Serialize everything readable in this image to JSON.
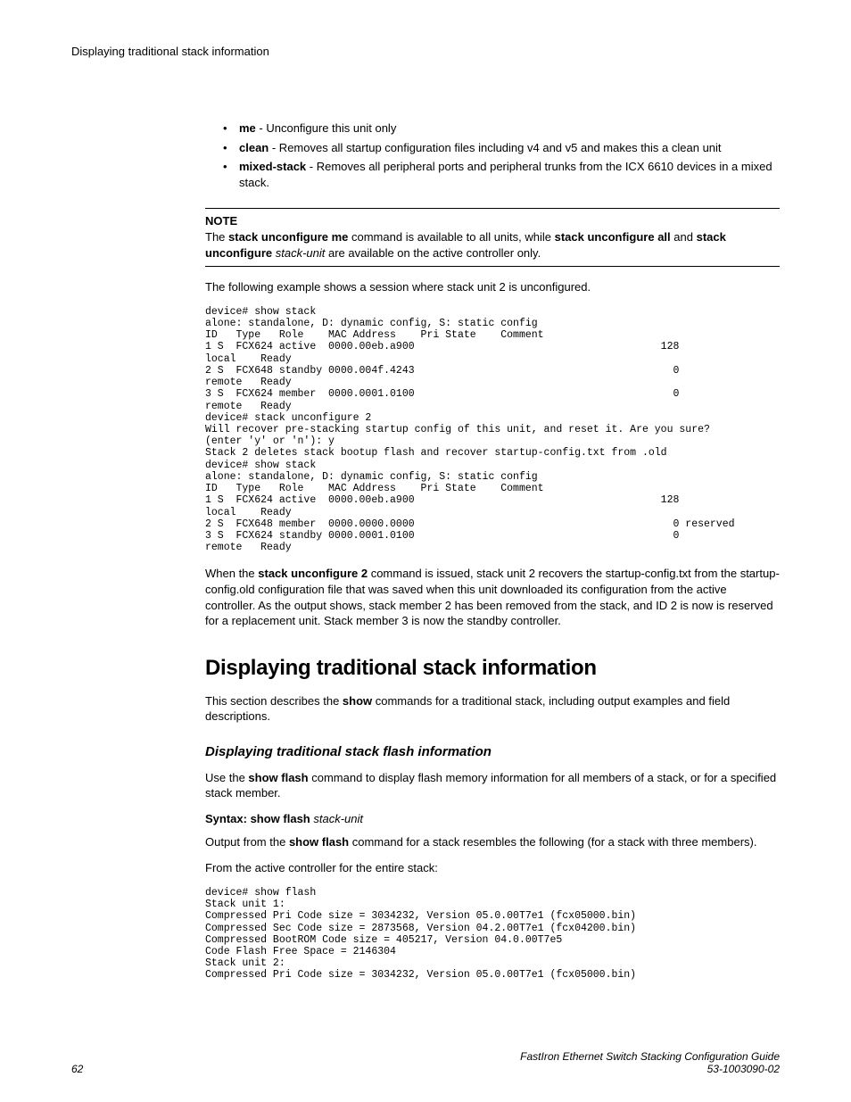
{
  "header": {
    "title": "Displaying traditional stack information"
  },
  "bullets": {
    "items": [
      {
        "term": "me",
        "desc": " - Unconfigure this unit only"
      },
      {
        "term": "clean",
        "desc": " - Removes all startup configuration files including v4 and v5 and makes this a clean unit"
      },
      {
        "term": "mixed-stack",
        "desc": " - Removes all peripheral ports and peripheral trunks from the ICX 6610 devices in a mixed stack."
      }
    ]
  },
  "note": {
    "label": "NOTE",
    "pre1": "The ",
    "b1": "stack unconfigure me",
    "mid1": " command is available to all units, while ",
    "b2": "stack unconfigure all",
    "mid2": " and ",
    "b3": "stack unconfigure",
    "i1": " stack-unit",
    "post": " are available on the active controller only."
  },
  "para1": "The following example shows a session where stack unit 2 is unconfigured.",
  "code1": "device# show stack\nalone: standalone, D: dynamic config, S: static config\nID   Type   Role    MAC Address    Pri State    Comment\n1 S  FCX624 active  0000.00eb.a900                                        128  \nlocal    Ready\n2 S  FCX648 standby 0000.004f.4243                                          0  \nremote   Ready\n3 S  FCX624 member  0000.0001.0100                                          0  \nremote   Ready\ndevice# stack unconfigure 2\nWill recover pre-stacking startup config of this unit, and reset it. Are you sure? \n(enter 'y' or 'n'): y\nStack 2 deletes stack bootup flash and recover startup-config.txt from .old\ndevice# show stack\nalone: standalone, D: dynamic config, S: static config\nID   Type   Role    MAC Address    Pri State    Comment\n1 S  FCX624 active  0000.00eb.a900                                        128  \nlocal    Ready\n2 S  FCX648 member  0000.0000.0000                                          0 reserved\n3 S  FCX624 standby 0000.0001.0100                                          0  \nremote   Ready",
  "para2": {
    "pre": "When the ",
    "b1": "stack unconfigure 2",
    "post": " command is issued, stack unit 2 recovers the startup-config.txt from the startup-config.old configuration file that was saved when this unit downloaded its configuration from the active controller. As the output shows, stack member 2 has been removed from the stack, and ID 2 is now is reserved for a replacement unit. Stack member 3 is now the standby controller."
  },
  "h1": "Displaying traditional stack information",
  "para3": {
    "pre": "This section describes the ",
    "b1": "show",
    "post": " commands for a traditional stack, including output examples and field descriptions."
  },
  "h2": "Displaying traditional stack flash information",
  "para4": {
    "pre": "Use the ",
    "b1": "show flash",
    "post": " command to display flash memory information for all members of a stack, or for a specified stack member."
  },
  "syntax": {
    "b1": "Syntax: show flash",
    "i1": " stack-unit"
  },
  "para5": {
    "pre": "Output from the ",
    "b1": "show flash",
    "post": " command for a stack resembles the following (for a stack with three members)."
  },
  "para6": "From the active controller for the entire stack:",
  "code2": "device# show flash\nStack unit 1:\nCompressed Pri Code size = 3034232, Version 05.0.00T7e1 (fcx05000.bin)\nCompressed Sec Code size = 2873568, Version 04.2.00T7e1 (fcx04200.bin)\nCompressed BootROM Code size = 405217, Version 04.0.00T7e5\nCode Flash Free Space = 2146304\nStack unit 2:\nCompressed Pri Code size = 3034232, Version 05.0.00T7e1 (fcx05000.bin)",
  "footer": {
    "page": "62",
    "title": "FastIron Ethernet Switch Stacking Configuration Guide",
    "docnum": "53-1003090-02"
  }
}
